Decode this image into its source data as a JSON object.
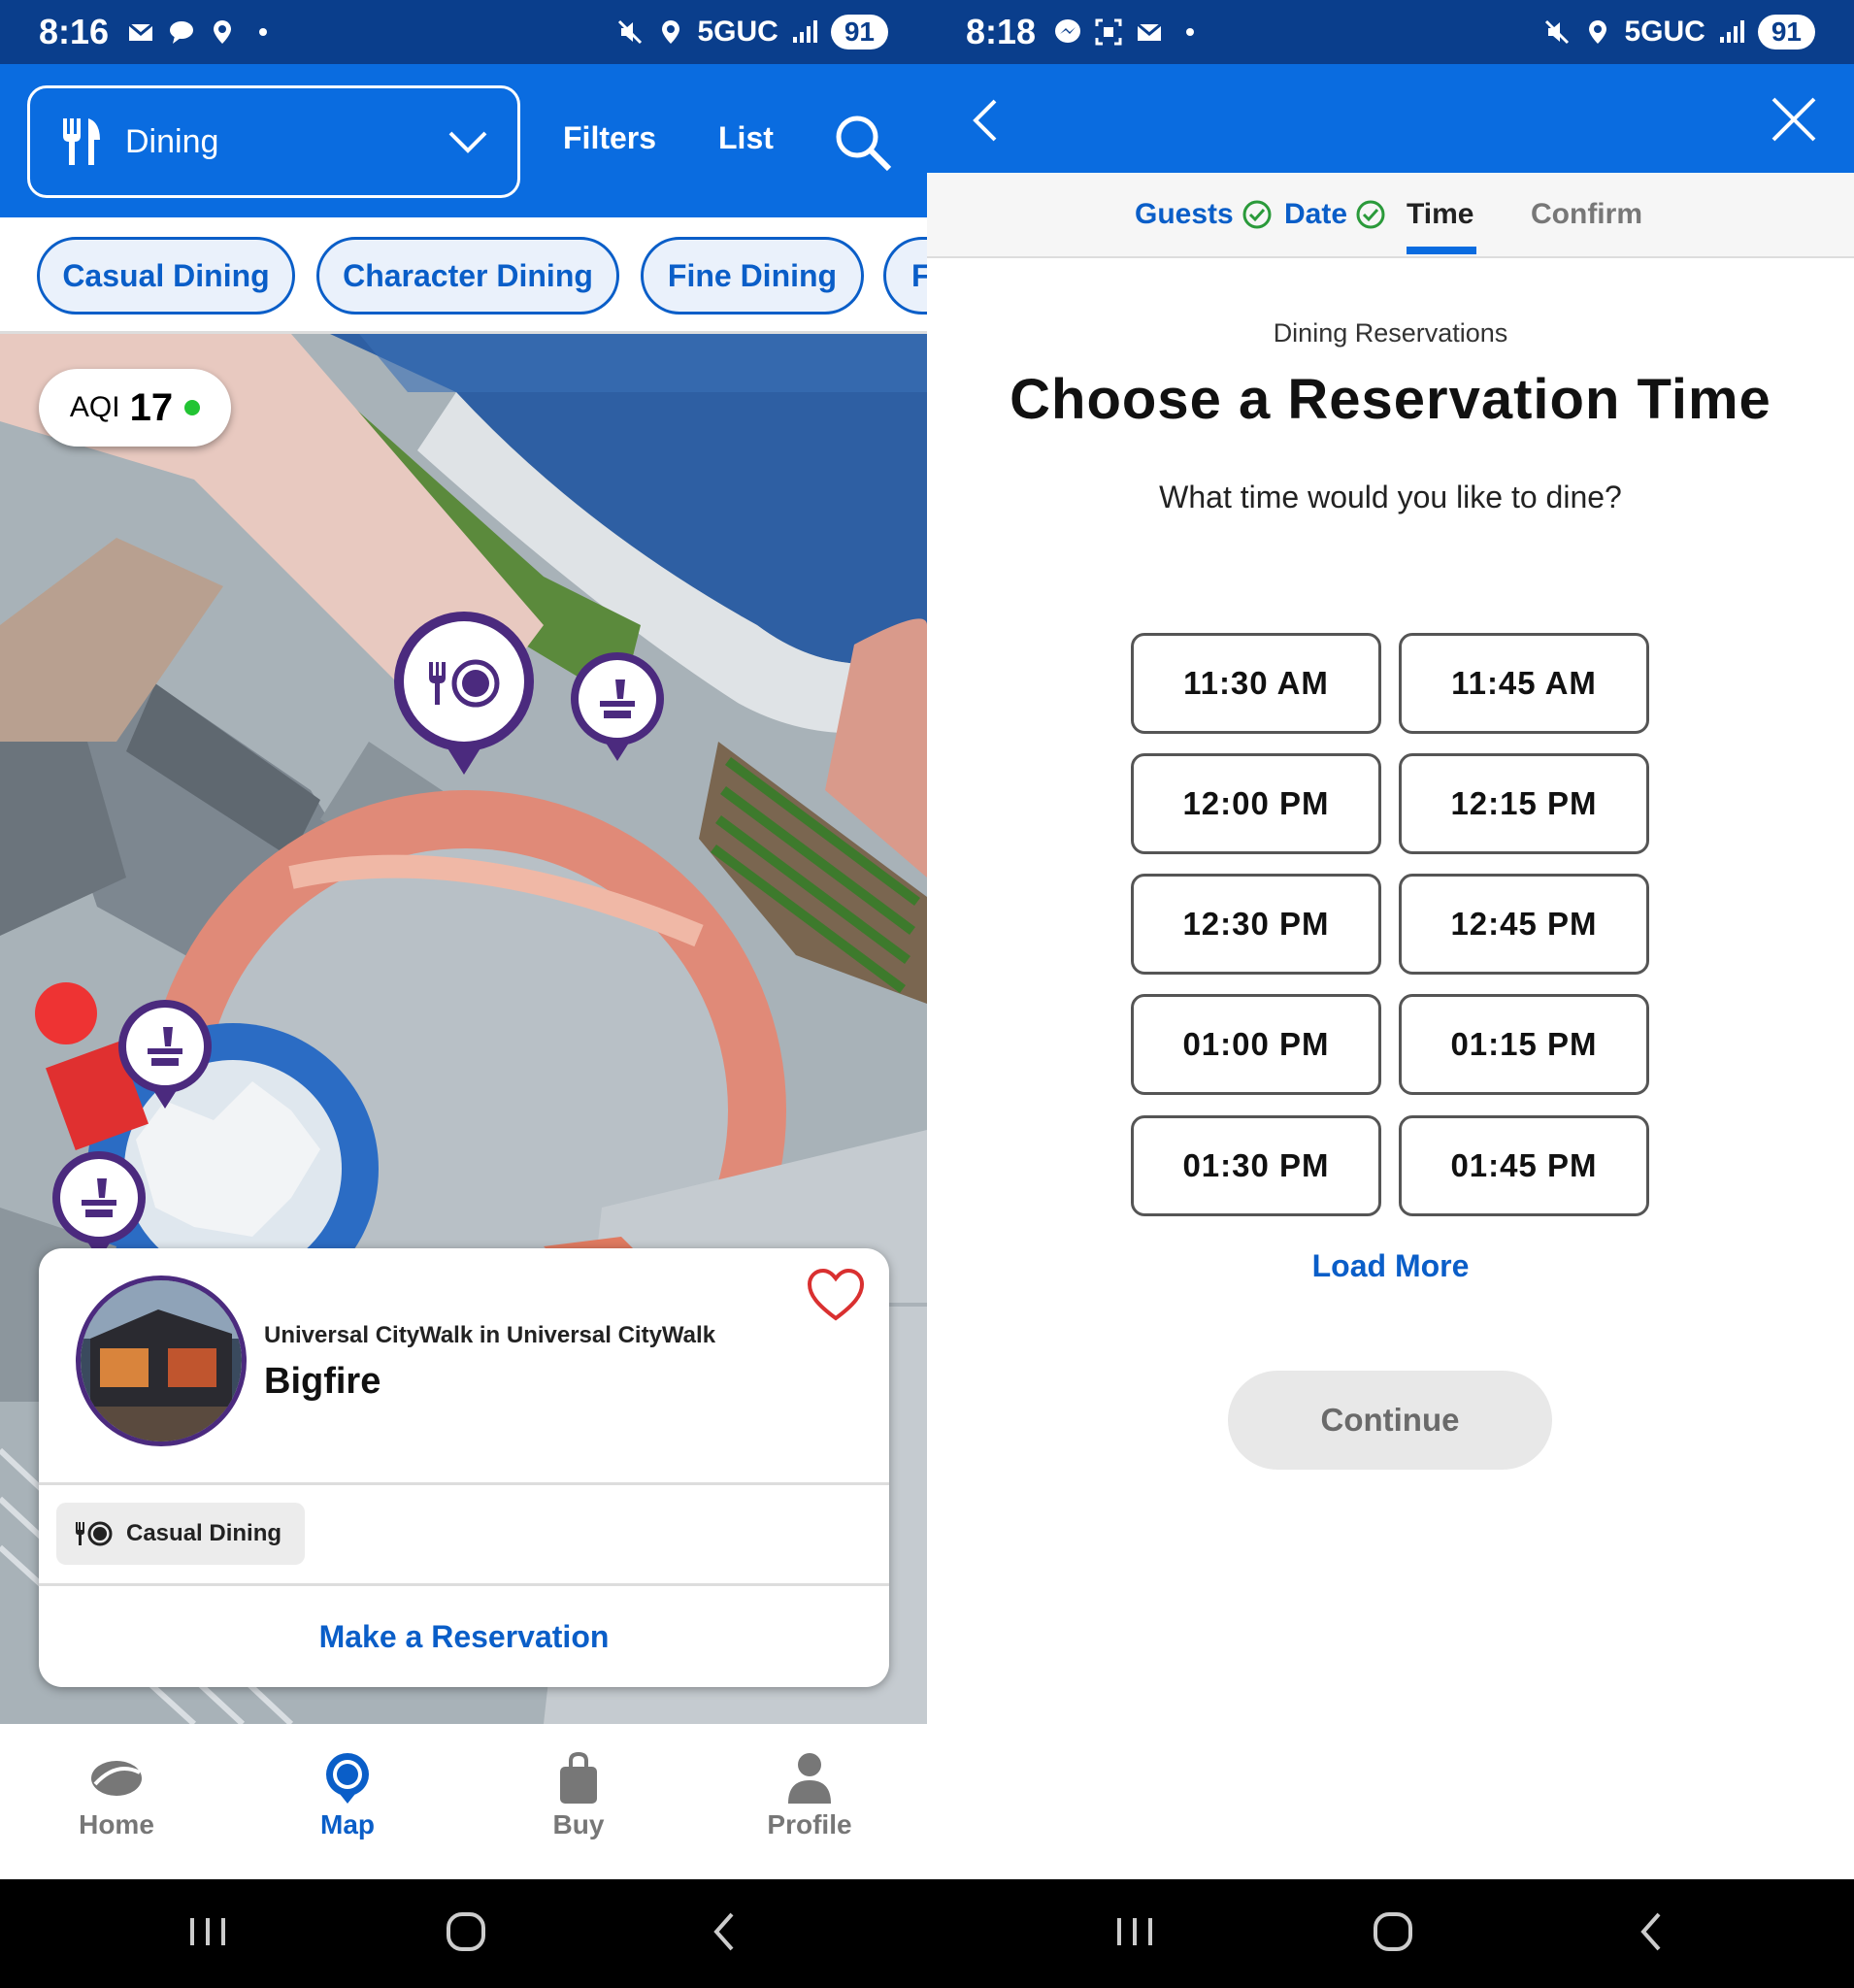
{
  "left": {
    "status": {
      "time": "8:16",
      "network": "5GUC",
      "battery": "91"
    },
    "header": {
      "category_label": "Dining",
      "filters_label": "Filters",
      "list_label": "List"
    },
    "chips": [
      "Casual Dining",
      "Character Dining",
      "Fine Dining",
      "F"
    ],
    "map": {
      "aqi_label": "AQI",
      "aqi_value": "17"
    },
    "card": {
      "location": "Universal CityWalk in Universal CityWalk",
      "name": "Bigfire",
      "tag": "Casual Dining",
      "action": "Make a Reservation"
    },
    "nav": [
      {
        "label": "Home",
        "icon": "home-icon"
      },
      {
        "label": "Map",
        "icon": "map-icon"
      },
      {
        "label": "Buy",
        "icon": "bag-icon"
      },
      {
        "label": "Profile",
        "icon": "person-icon"
      }
    ],
    "active_nav": "Map"
  },
  "right": {
    "status": {
      "time": "8:18",
      "network": "5GUC",
      "battery": "91"
    },
    "steps": [
      {
        "label": "Guests",
        "state": "done"
      },
      {
        "label": "Date",
        "state": "done"
      },
      {
        "label": "Time",
        "state": "current"
      },
      {
        "label": "Confirm",
        "state": "todo"
      }
    ],
    "eyebrow": "Dining Reservations",
    "title": "Choose a Reservation Time",
    "subtitle": "What time would you like to dine?",
    "times": [
      "11:30 AM",
      "11:45 AM",
      "12:00 PM",
      "12:15 PM",
      "12:30 PM",
      "12:45 PM",
      "01:00 PM",
      "01:15 PM",
      "01:30 PM",
      "01:45 PM"
    ],
    "load_more": "Load More",
    "continue": "Continue"
  },
  "colors": {
    "brand_blue": "#0a6ce0",
    "status_blue": "#0a3e8c",
    "link_blue": "#0a5ec8",
    "pin_purple": "#4b2a7e",
    "fav_red": "#d93030"
  }
}
